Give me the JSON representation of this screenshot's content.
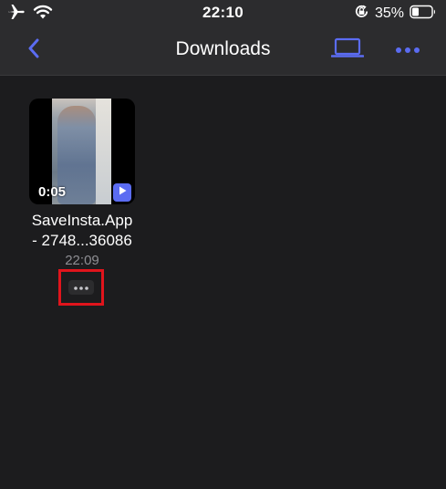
{
  "status_bar": {
    "time": "22:10",
    "battery_percent": "35%",
    "battery_level": 0.35
  },
  "nav": {
    "title": "Downloads"
  },
  "files": [
    {
      "name_line1": "SaveInsta.App",
      "name_line2": "- 2748...36086",
      "time": "22:09",
      "duration": "0:05"
    }
  ],
  "colors": {
    "accent": "#5b6cf2",
    "background": "#1c1c1e",
    "bar": "#2c2c2e",
    "highlight": "#e0141c",
    "secondary_text": "#8e8e93"
  },
  "icons": {
    "airplane": "airplane-icon",
    "wifi": "wifi-icon",
    "orientation_lock": "orientation-lock-icon",
    "battery": "battery-icon",
    "back": "chevron-left-icon",
    "laptop": "laptop-icon",
    "more": "ellipsis-icon",
    "play": "play-icon"
  }
}
